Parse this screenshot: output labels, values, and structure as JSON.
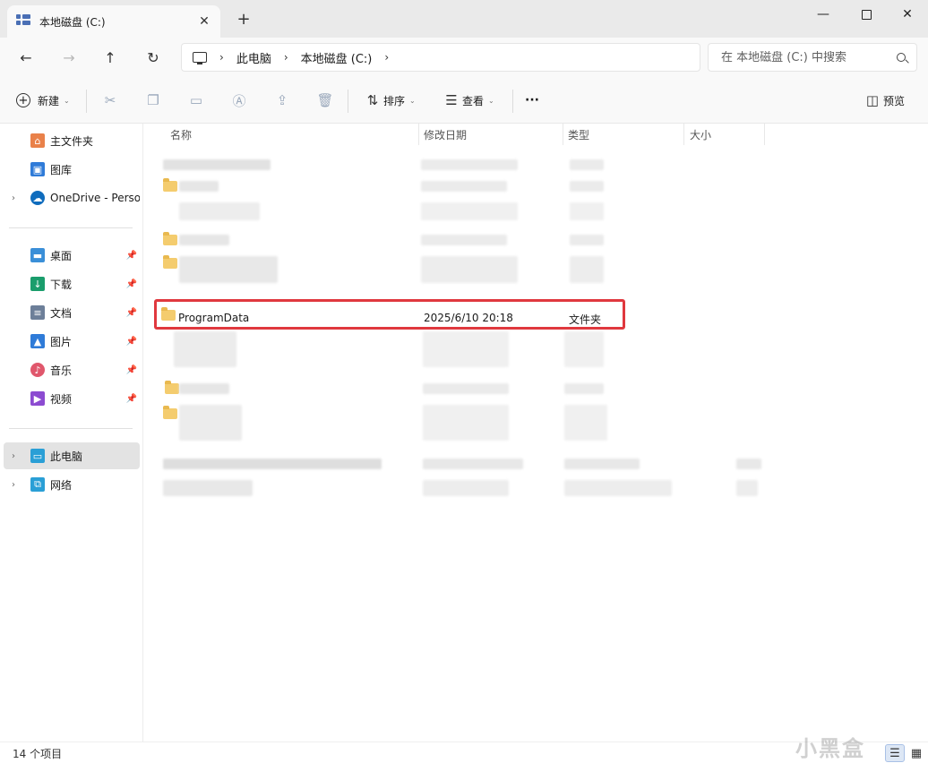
{
  "window": {
    "tab_title": "本地磁盘 (C:)",
    "new_tab": "+",
    "minimize": "—",
    "close": "✕"
  },
  "address": {
    "crumbs": [
      "此电脑",
      "本地磁盘 (C:)"
    ],
    "search_placeholder": "在 本地磁盘 (C:) 中搜索"
  },
  "toolbar": {
    "new_label": "新建",
    "sort_label": "排序",
    "view_label": "查看",
    "more_label": "···",
    "preview_label": "预览"
  },
  "sidebar": {
    "items": [
      {
        "label": "主文件夹",
        "icon": "home-icon",
        "color": "#e9814a"
      },
      {
        "label": "图库",
        "icon": "gallery-icon",
        "color": "#2f7bd8"
      },
      {
        "label": "OneDrive - Perso",
        "icon": "onedrive-icon",
        "color": "#0f6cbd"
      },
      {
        "label": "桌面",
        "icon": "desktop-icon",
        "color": "#3a8fd8"
      },
      {
        "label": "下载",
        "icon": "download-icon",
        "color": "#1a9d6c"
      },
      {
        "label": "文档",
        "icon": "document-icon",
        "color": "#6d7f99"
      },
      {
        "label": "图片",
        "icon": "pictures-icon",
        "color": "#2f7bd8"
      },
      {
        "label": "音乐",
        "icon": "music-icon",
        "color": "#e0576c"
      },
      {
        "label": "视频",
        "icon": "video-icon",
        "color": "#8c4bd1"
      },
      {
        "label": "此电脑",
        "icon": "this-pc-icon",
        "color": "#2a9fd6"
      },
      {
        "label": "网络",
        "icon": "network-icon",
        "color": "#2a9fd6"
      }
    ]
  },
  "columns": {
    "name": "名称",
    "date": "修改日期",
    "type": "类型",
    "size": "大小"
  },
  "highlighted_row": {
    "name": "ProgramData",
    "date": "2025/6/10 20:18",
    "type": "文件夹"
  },
  "status": {
    "item_count": "14 个项目"
  },
  "watermark": "小黑盒",
  "colors": {
    "highlight_border": "#e0383e",
    "folder": "#f4cc6e",
    "selected_nav": "#e3e3e3"
  }
}
